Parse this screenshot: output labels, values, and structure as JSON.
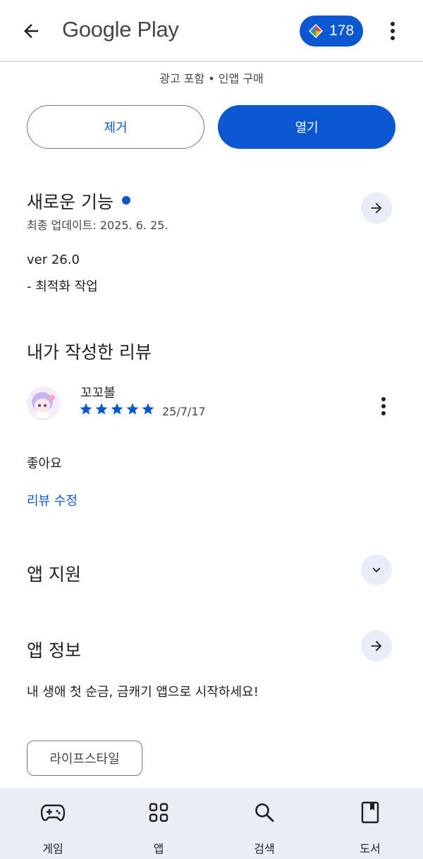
{
  "header": {
    "title": "Google Play",
    "points": "178"
  },
  "app": {
    "sub_info": "광고 포함 • 인앱 구매",
    "remove_label": "제거",
    "open_label": "열기"
  },
  "whats_new": {
    "title": "새로운 기능",
    "updated": "최종 업데이트: 2025. 6. 25.",
    "version": "ver 26.0",
    "note": "- 최적화 작업"
  },
  "my_review": {
    "title": "내가 작성한 리뷰",
    "reviewer": "꼬꼬볼",
    "rating": 5,
    "date": "25/7/17",
    "text": "좋아요",
    "edit_label": "리뷰 수정"
  },
  "app_support": {
    "title": "앱 지원"
  },
  "app_info": {
    "title": "앱 정보",
    "description": "내 생애 첫 순금, 금캐기 앱으로 시작하세요!",
    "category": "라이프스타일"
  },
  "bottom_nav": {
    "items": [
      {
        "label": "게임",
        "icon": "gamepad-icon"
      },
      {
        "label": "앱",
        "icon": "apps-grid-icon"
      },
      {
        "label": "검색",
        "icon": "search-icon"
      },
      {
        "label": "도서",
        "icon": "book-icon"
      }
    ]
  },
  "colors": {
    "accent": "#0b57d0",
    "nav_bg": "#e9eef6",
    "circle_btn_bg": "#e8edf7"
  }
}
